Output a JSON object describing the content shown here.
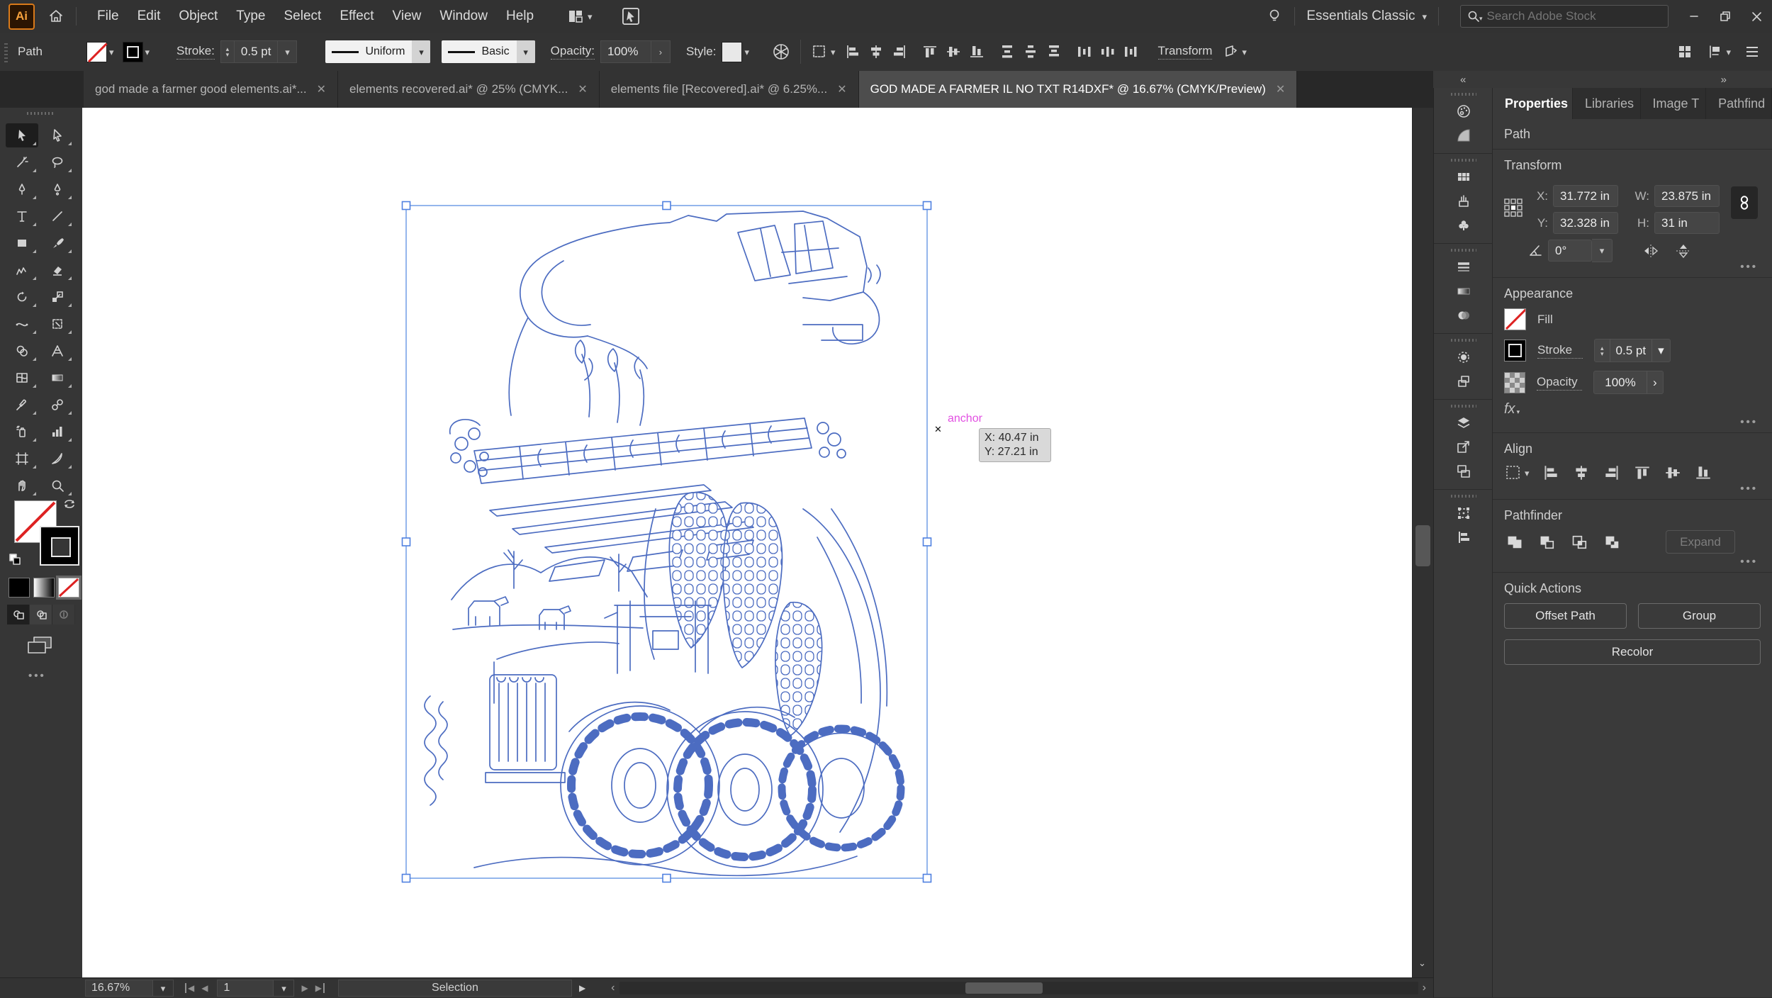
{
  "app": {
    "logo": "Ai",
    "menus": [
      "File",
      "Edit",
      "Object",
      "Type",
      "Select",
      "Effect",
      "View",
      "Window",
      "Help"
    ],
    "workspace": "Essentials Classic",
    "search_placeholder": "Search Adobe Stock"
  },
  "control_bar": {
    "target": "Path",
    "stroke_label": "Stroke:",
    "stroke_value": "0.5 pt",
    "width_profile": "Uniform",
    "brush": "Basic",
    "opacity_label": "Opacity:",
    "opacity_value": "100%",
    "style_label": "Style:",
    "transform_label": "Transform"
  },
  "document_tabs": [
    {
      "label": "god made a farmer good elements.ai*...",
      "active": false
    },
    {
      "label": "elements recovered.ai* @ 25% (CMYK...",
      "active": false
    },
    {
      "label": "elements file [Recovered].ai* @ 6.25%...",
      "active": false
    },
    {
      "label": "GOD MADE A FARMER IL NO TXT R14DXF* @ 16.67% (CMYK/Preview)",
      "active": true
    }
  ],
  "tools": [
    "selection",
    "direct-selection",
    "magic-wand",
    "lasso",
    "pen",
    "curvature",
    "type",
    "line-segment",
    "rectangle",
    "paintbrush",
    "shaper",
    "eraser",
    "rotate",
    "scale",
    "width",
    "free-transform",
    "shape-builder",
    "perspective-grid",
    "mesh",
    "gradient",
    "eyedropper",
    "blend",
    "symbol-sprayer",
    "column-graph",
    "artboard",
    "slice",
    "hand",
    "zoom"
  ],
  "active_tool": "selection",
  "dock_panels": [
    "color",
    "color-guide",
    "swatches",
    "brushes",
    "symbols",
    "stroke",
    "gradient",
    "transparency",
    "appearance",
    "graphic-styles",
    "layers",
    "asset-export",
    "artboards",
    "transform",
    "align"
  ],
  "canvas": {
    "anchor_label": "anchor",
    "tooltip_x": "X: 40.47 in",
    "tooltip_y": "Y: 27.21 in"
  },
  "properties_panel": {
    "tabs": [
      "Properties",
      "Libraries",
      "Image T",
      "Pathfind"
    ],
    "active_tab": "Properties",
    "object_type": "Path",
    "transform": {
      "title": "Transform",
      "x_label": "X:",
      "x": "31.772 in",
      "y_label": "Y:",
      "y": "32.328 in",
      "w_label": "W:",
      "w": "23.875 in",
      "h_label": "H:",
      "h": "31 in",
      "angle": "0°"
    },
    "appearance": {
      "title": "Appearance",
      "fill_label": "Fill",
      "stroke_label": "Stroke",
      "stroke_value": "0.5 pt",
      "opacity_label": "Opacity",
      "opacity_value": "100%",
      "fx_label": "fx"
    },
    "align": {
      "title": "Align"
    },
    "pathfinder": {
      "title": "Pathfinder",
      "expand_label": "Expand"
    },
    "quick_actions": {
      "title": "Quick Actions",
      "offset_path": "Offset Path",
      "group": "Group",
      "recolor": "Recolor"
    }
  },
  "status_bar": {
    "zoom": "16.67%",
    "artboard": "1",
    "status": "Selection"
  },
  "colors": {
    "selection_blue": "#4f80e0",
    "artwork_blue": "#4c6cc1",
    "anchor_magenta": "#e24fe2",
    "ai_orange": "#f5a13d"
  }
}
